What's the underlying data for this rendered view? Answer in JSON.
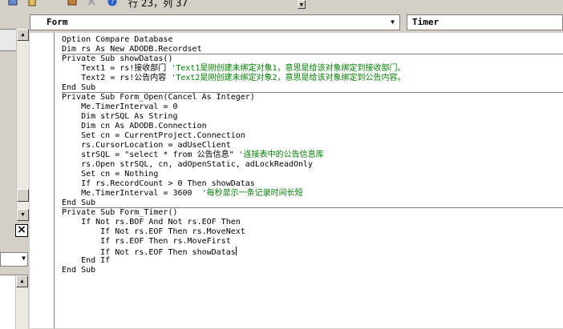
{
  "toolbar": {
    "status_position": "行 23，列 37",
    "icons": [
      "tools-icon",
      "object-browser-icon",
      "toolbox-icon",
      "help-icon"
    ]
  },
  "code_window": {
    "object_selector": "Form",
    "procedure_selector": "Timer"
  },
  "code": {
    "lines": [
      {
        "text": "Option Compare Database",
        "comment": ""
      },
      {
        "text": "Dim rs As New ADODB.Recordset",
        "comment": ""
      },
      {
        "text": "Private Sub showDatas()",
        "comment": ""
      },
      {
        "text": "    Text1 = rs!接收部门 ",
        "comment": "'Text1是刚创建未绑定对象1，意思是给该对象绑定到接收部门。"
      },
      {
        "text": "    Text2 = rs!公告内容 ",
        "comment": "'Text2是刚创建未绑定对象2，意思是给该对象绑定到公告内容。"
      },
      {
        "text": "End Sub",
        "comment": ""
      },
      {
        "text": "Private Sub Form_Open(Cancel As Integer)",
        "comment": ""
      },
      {
        "text": "    Me.TimerInterval = 0",
        "comment": ""
      },
      {
        "text": "    Dim strSQL As String",
        "comment": ""
      },
      {
        "text": "    Dim cn As ADODB.Connection",
        "comment": ""
      },
      {
        "text": "    Set cn = CurrentProject.Connection",
        "comment": ""
      },
      {
        "text": "    rs.CursorLocation = adUseClient",
        "comment": ""
      },
      {
        "text": "    strSQL = \"select * from 公告信息\" ",
        "comment": "'连接表中的公告信息库"
      },
      {
        "text": "    rs.Open strSQL, cn, adOpenStatic, adLockReadOnly",
        "comment": ""
      },
      {
        "text": "    Set cn = Nothing",
        "comment": ""
      },
      {
        "text": "    If rs.RecordCount > 0 Then showDatas",
        "comment": ""
      },
      {
        "text": "    Me.TimerInterval = 3600  ",
        "comment": "'每秒显示一条记录时间长短"
      },
      {
        "text": "End Sub",
        "comment": ""
      },
      {
        "text": "Private Sub Form_Timer()",
        "comment": ""
      },
      {
        "text": "    If Not rs.BOF And Not rs.EOF Then",
        "comment": ""
      },
      {
        "text": "        If Not rs.EOF Then rs.MoveNext",
        "comment": ""
      },
      {
        "text": "        If rs.EOF Then rs.MoveFirst",
        "comment": ""
      },
      {
        "text": "        If Not rs.EOF Then showDatas",
        "comment": ""
      },
      {
        "text": "    End If",
        "comment": ""
      },
      {
        "text": "End Sub",
        "comment": ""
      }
    ]
  }
}
